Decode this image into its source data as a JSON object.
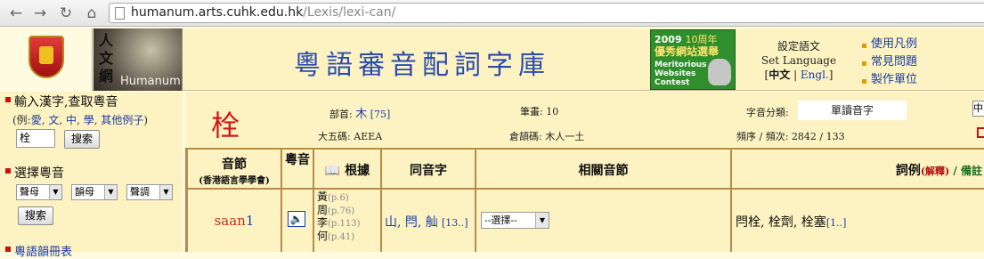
{
  "browser": {
    "url_host": "humanum.arts.cuhk.edu.hk",
    "url_path": "/Lexis/lexi-can/"
  },
  "banner": {
    "humanum_chars": "人文網",
    "humanum_label": "Humanum",
    "site_title": "粵語審音配詞字庫",
    "award": {
      "year": "2009",
      "tag": "10周年",
      "zh": "優秀網站選舉",
      "en": "Meritorious Websites Contest"
    },
    "lang": {
      "title": "設定語文",
      "subtitle": "Set Language",
      "zh": "中文",
      "en": "Engl."
    },
    "menu": [
      "使用凡例",
      "常見問題",
      "製作單位"
    ]
  },
  "sidebar": {
    "input_heading": "輸入漢字,查取粵音",
    "example_prefix": "(例:",
    "examples": [
      "愛",
      "文",
      "中",
      "學",
      "其他例子"
    ],
    "example_suffix": ")",
    "input_value": "栓",
    "search_label": "搜索",
    "select_heading": "選擇粵音",
    "select_initial": "聲母",
    "select_final": "韻母",
    "select_tone": "聲調",
    "search2_label": "搜索",
    "bottom_link": "粵語韻冊表"
  },
  "info": {
    "char": "栓",
    "radical_label": "部首:",
    "radical_char": "木",
    "radical_num": "[75]",
    "strokes_label": "筆畫:",
    "strokes": "10",
    "category_label": "字音分類:",
    "category": "單讀音字",
    "big5_label": "大五碼:",
    "big5": "AEEA",
    "cangjie_label": "倉頡碼:",
    "cangjie": "木人一土",
    "freq_label": "頻序 / 頻次:",
    "freq": "2842 / 133",
    "edge_box": "中"
  },
  "table": {
    "headers": {
      "syllable": "音節",
      "syllable_sub": "(香港語言學學會)",
      "audio": "粵音",
      "source": "根據",
      "homophone": "同音字",
      "related": "相關音節",
      "examples": "詞例",
      "examples_note": "(解釋)",
      "notes": " / 備註"
    },
    "row": {
      "initial": "saan",
      "tone": "1",
      "sources": [
        {
          "c": "黃",
          "p": "(p.6)"
        },
        {
          "c": "周",
          "p": "(p.76)"
        },
        {
          "c": "李",
          "p": "(p.113)"
        },
        {
          "c": "何",
          "p": "(p.41)"
        }
      ],
      "homophones": "山, 閂, 舢",
      "homophones_more": "[13..]",
      "related_select": "--選擇--",
      "words": "閂栓, 栓劑, 栓塞",
      "words_more": "[1..]"
    }
  }
}
